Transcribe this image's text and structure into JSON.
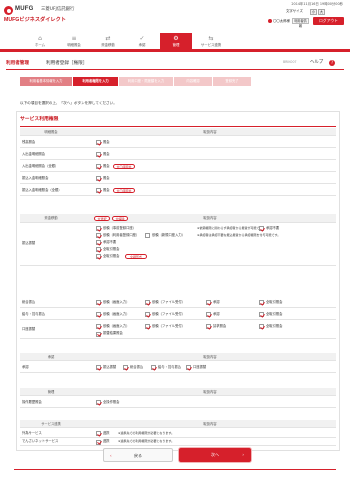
{
  "header": {
    "brand": "MUFG",
    "bank_name": "三菱UFJ信託銀行",
    "service_name": "MUFGビジネスダイレクト",
    "datetime": "2014年11月16日 19時00分00秒",
    "font_size_label": "文字サイズ",
    "font_small": "小",
    "font_large": "大",
    "user_name": "〇〇太郎様",
    "user_info_button": "利用者情報",
    "logout": "ログアウト"
  },
  "nav": [
    {
      "label": "ホーム",
      "icon": "home-icon"
    },
    {
      "label": "明細照会",
      "icon": "list-icon"
    },
    {
      "label": "資金移動",
      "icon": "transfer-icon"
    },
    {
      "label": "承認",
      "icon": "approve-icon"
    },
    {
      "label": "管理",
      "icon": "manage-icon"
    },
    {
      "label": "サービス連携",
      "icon": "link-icon"
    }
  ],
  "page": {
    "title": "利用者管理",
    "subtitle": "利用者登録［権限］",
    "code": "BRIK007",
    "help": "ヘルプ",
    "help_icon": "?"
  },
  "steps": [
    "利用者基本情報を入力",
    "利用者権限を入力",
    "利用口座・限度額を入力",
    "内容確認",
    "登録完了"
  ],
  "intro": "以下の項目を選択の上、「次へ」ボタンを押してください。",
  "section_title": "サービス利用権限",
  "table1": {
    "head": [
      "明細照会",
      "取扱内容"
    ],
    "rows": [
      {
        "label": "残高照会",
        "items": [
          "照会"
        ]
      },
      {
        "label": "入出金明細照会",
        "items": [
          "照会"
        ]
      },
      {
        "label": "入出金明細照会（全銀）",
        "items": [
          "照会",
          "全口座照会"
        ]
      },
      {
        "label": "振込入金明細照会",
        "items": [
          "照会"
        ]
      },
      {
        "label": "振込入金明細照会（全銀）",
        "items": [
          "照会",
          "全口座照会"
        ]
      }
    ]
  },
  "table2": {
    "head": [
      "資金移動",
      "取扱内容"
    ],
    "select_all": "全選択",
    "clear_all": "全解除",
    "furikomi": {
      "label": "振込振替",
      "items": [
        "依頼（事前登録口座）",
        "依頼（利用者登録口座）",
        "依頼（新規口座入力）",
        "承認不要",
        "全取引照会",
        "全銀形式"
      ],
      "note_right": "承認不要",
      "notes": [
        "※依頼権限に関わらず承認者から振替が可能です。",
        "※承認者は承認不要な振込振替から承認権限を付与可能です。"
      ],
      "sub_label": "全取引照会"
    },
    "sogo": {
      "label": "総合振込",
      "items": [
        "依頼（画面入力）",
        "依頼（ファイル受付）",
        "承認",
        "全取引照会"
      ]
    },
    "kyuyo": {
      "label": "給与・賞与振込",
      "items": [
        "依頼（画面入力）",
        "依頼（ファイル受付）",
        "承認",
        "全取引照会"
      ]
    },
    "koza": {
      "label": "口座振替",
      "items": [
        "依頼（画面入力）",
        "依頼（ファイル受付）",
        "請求照会",
        "全取引照会",
        "振替結果照会"
      ]
    }
  },
  "table3": {
    "head": [
      "承認",
      "取扱内容"
    ],
    "label": "承認",
    "items": [
      "振込振替",
      "総合振込",
      "給与・賞与振込",
      "口座振替"
    ]
  },
  "table4": {
    "head": [
      "管理",
      "取扱内容"
    ],
    "label": "操作履歴照会",
    "items": [
      "全操作照会"
    ]
  },
  "table5": {
    "head": [
      "サービス連携",
      "取扱内容"
    ],
    "rows": [
      {
        "label": "外為サービス",
        "items": [
          "連携"
        ],
        "note": "※連携先での利用権限が必要となります。"
      },
      {
        "label": "でんさいネットサービス",
        "items": [
          "連携"
        ],
        "note": "※連携先での利用権限が必要となります。"
      }
    ]
  },
  "buttons": {
    "back": "戻る",
    "next": "次へ"
  },
  "colors": {
    "accent": "#d6202b",
    "step_done": "#e27f84",
    "step_next": "#f3c8c9"
  }
}
